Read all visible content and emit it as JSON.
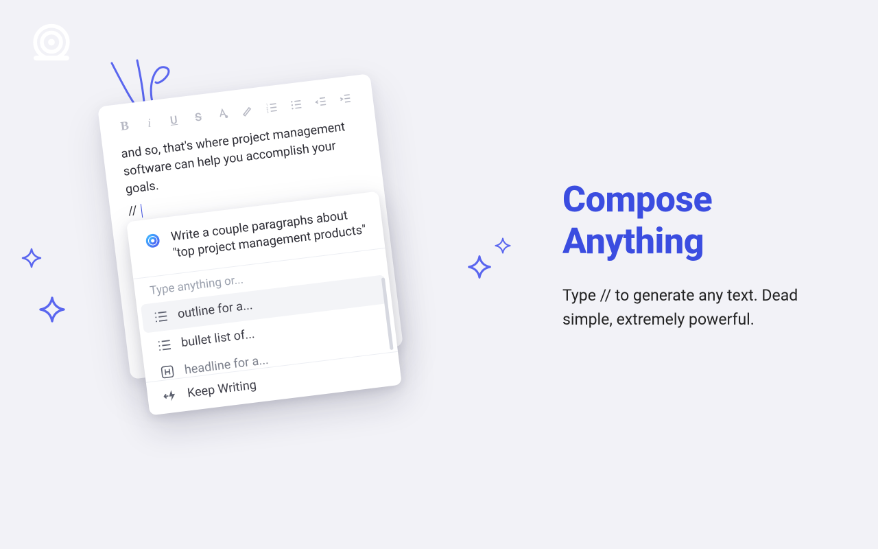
{
  "marketing": {
    "title_line1": "Compose",
    "title_line2": "Anything",
    "body": "Type // to generate any text. Dead simple, extremely powerful."
  },
  "editor": {
    "toolbar": {
      "items": [
        "bold",
        "italic",
        "underline",
        "strikethrough",
        "font-color",
        "highlight",
        "ordered-list",
        "unordered-list",
        "outdent",
        "indent"
      ]
    },
    "body_text": "and so, that's where project management software can help you accomplish your goals.",
    "slash_trigger": "// "
  },
  "popover": {
    "prompt": "Write a couple paragraphs about \"top project management products\"",
    "hint": "Type anything or...",
    "options": [
      {
        "icon": "list",
        "label": "outline for a..."
      },
      {
        "icon": "list",
        "label": "bullet list of..."
      },
      {
        "icon": "heading",
        "label": "headline for a..."
      }
    ],
    "footer": {
      "icon": "bolt",
      "label": "Keep Writing"
    }
  },
  "colors": {
    "accent": "#3b4de0",
    "sparkle": "#5a66ef"
  }
}
